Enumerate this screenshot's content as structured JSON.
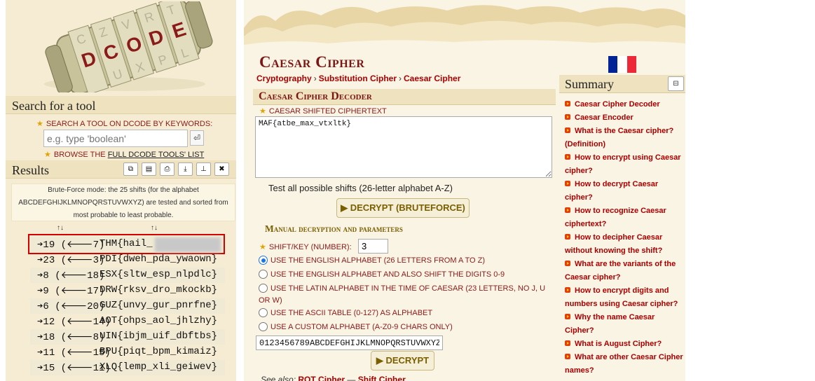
{
  "logo": {
    "text": "DCODE",
    "brand_color": "#8b1a1a"
  },
  "left": {
    "search_title": "Search for a tool",
    "search_label": "SEARCH A TOOL ON DCODE BY KEYWORDS:",
    "search_placeholder": "e.g. type 'boolean'",
    "search_go": "⏎",
    "browse_prefix": "BROWSE THE ",
    "browse_link": "FULL DCODE TOOLS' LIST",
    "results_title": "Results",
    "toolbar": [
      "copy-icon",
      "clipboard-icon",
      "print-icon",
      "download-icon",
      "pin-icon",
      "close-icon"
    ],
    "bruteforce_note": "Brute-Force mode: the 25 shifts (for the alphabet ABCDEFGHIJKLMNOPQRSTUVWXYZ) are tested and sorted from most probable to least probable.",
    "table_headers": [
      "↑↓",
      "↑↓"
    ],
    "rows": [
      {
        "shift": "➔19 (🡐7)",
        "text": "THM{hail_"
      },
      {
        "shift": "➔23 (🡐3)",
        "text": "PDI{dweh_pda_ywaown}"
      },
      {
        "shift": "➔8 (🡐18)",
        "text": "ESX{sltw_esp_nlpdlc}"
      },
      {
        "shift": "➔9 (🡐17)",
        "text": "DRW{rksv_dro_mkockb}"
      },
      {
        "shift": "➔6 (🡐20)",
        "text": "GUZ{unvy_gur_pnrfne}"
      },
      {
        "shift": "➔12 (🡐14)",
        "text": "AOT{ohps_aol_jhlzhy}"
      },
      {
        "shift": "➔18 (🡐8)",
        "text": "UIN{ibjm_uif_dbftbs}"
      },
      {
        "shift": "➔11 (🡐15)",
        "text": "BPU{piqt_bpm_kimaiz}"
      },
      {
        "shift": "➔15 (🡐11)",
        "text": "XLQ{lemp_xli_geiwev}"
      }
    ]
  },
  "main": {
    "title": "Caesar Cipher",
    "breadcrumbs": [
      "Cryptography",
      "Substitution Cipher",
      "Caesar Cipher"
    ],
    "breadcrumb_sep": "›",
    "decoder_title": "Caesar Cipher Decoder",
    "ciphertext_label": "CAESAR SHIFTED CIPHERTEXT",
    "ciphertext_value": "MAF{atbe_max_vtxltk}",
    "test_all_label": "Test all possible shifts (26-letter alphabet A-Z)",
    "bruteforce_button": "▶ DECRYPT (BRUTEFORCE)",
    "manual_title": "Manual decryption and parameters",
    "shift_label": "SHIFT/KEY (NUMBER):",
    "shift_value": "3",
    "alphabet_options": [
      {
        "label": "USE THE ENGLISH ALPHABET (26 LETTERS FROM A TO Z)",
        "selected": true
      },
      {
        "label": "USE THE ENGLISH ALPHABET AND ALSO SHIFT THE DIGITS 0-9",
        "selected": false
      },
      {
        "label": "USE THE LATIN ALPHABET IN THE TIME OF CAESAR (23 LETTERS, NO J, U OR W)",
        "selected": false
      },
      {
        "label": "USE THE ASCII TABLE (0-127) AS ALPHABET",
        "selected": false
      },
      {
        "label": "USE A CUSTOM ALPHABET (A-Z0-9 CHARS ONLY)",
        "selected": false
      }
    ],
    "custom_alphabet": "0123456789ABCDEFGHIJKLMNOPQRSTUVWXYZ",
    "decrypt_button": "▶ DECRYPT",
    "see_also_label": "See also:",
    "see_also_links": [
      "ROT Cipher",
      "Shift Cipher"
    ],
    "see_also_sep": " — "
  },
  "summary": {
    "title": "Summary",
    "toggle": "⊟",
    "items": [
      "Caesar Cipher Decoder",
      "Caesar Encoder",
      "What is the Caesar cipher? (Definition)",
      "How to encrypt using Caesar cipher?",
      "How to decrypt Caesar cipher?",
      "How to recognize Caesar ciphertext?",
      "How to decipher Caesar without knowing the shift?",
      "What are the variants of the Caesar cipher?",
      "How to encrypt digits and numbers using Caesar cipher?",
      "Why the name Caesar Cipher?",
      "What is August Cipher?",
      "What are other Caesar Cipher names?"
    ]
  },
  "flag_colors": [
    "#002395",
    "#ffffff",
    "#ed2939"
  ]
}
